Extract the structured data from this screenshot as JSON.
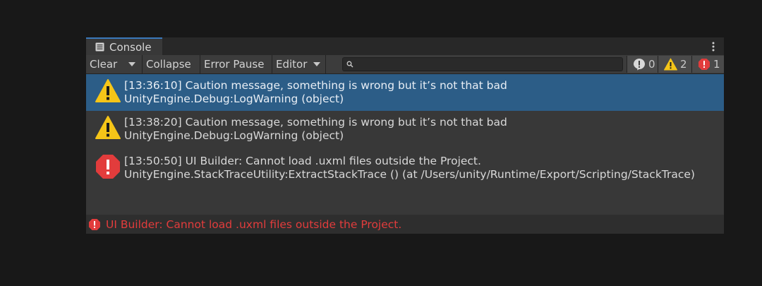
{
  "tab": {
    "title": "Console"
  },
  "toolbar": {
    "clear_label": "Clear",
    "collapse_label": "Collapse",
    "error_pause_label": "Error Pause",
    "editor_label": "Editor",
    "search_placeholder": ""
  },
  "counters": {
    "info_count": "0",
    "warning_count": "2",
    "error_count": "1"
  },
  "entries": [
    {
      "type": "warning",
      "message": "[13:36:10] Caution message, something is wrong but it’s not that bad",
      "source": "UnityEngine.Debug:LogWarning (object)",
      "selected": true
    },
    {
      "type": "warning",
      "message": "[13:38:20] Caution message, something is wrong but it’s not that bad",
      "source": "UnityEngine.Debug:LogWarning (object)",
      "selected": false
    },
    {
      "type": "error",
      "message": "[13:50:50] UI Builder: Cannot load .uxml files outside the Project.",
      "source": "UnityEngine.StackTraceUtility:ExtractStackTrace () (at /Users/unity/Runtime/Export/Scripting/StackTrace)",
      "selected": false
    }
  ],
  "status": {
    "message": "UI Builder: Cannot load .uxml files outside the Project."
  },
  "colors": {
    "warning": "#f5c518",
    "error": "#e23c3c",
    "selection": "#2c5d87",
    "tab_accent": "#3a79bb"
  },
  "icons": {
    "tab": "console-icon",
    "menu": "kebab-menu-icon",
    "search": "search-icon",
    "info": "info-icon",
    "warning": "warning-icon",
    "error": "error-icon"
  }
}
